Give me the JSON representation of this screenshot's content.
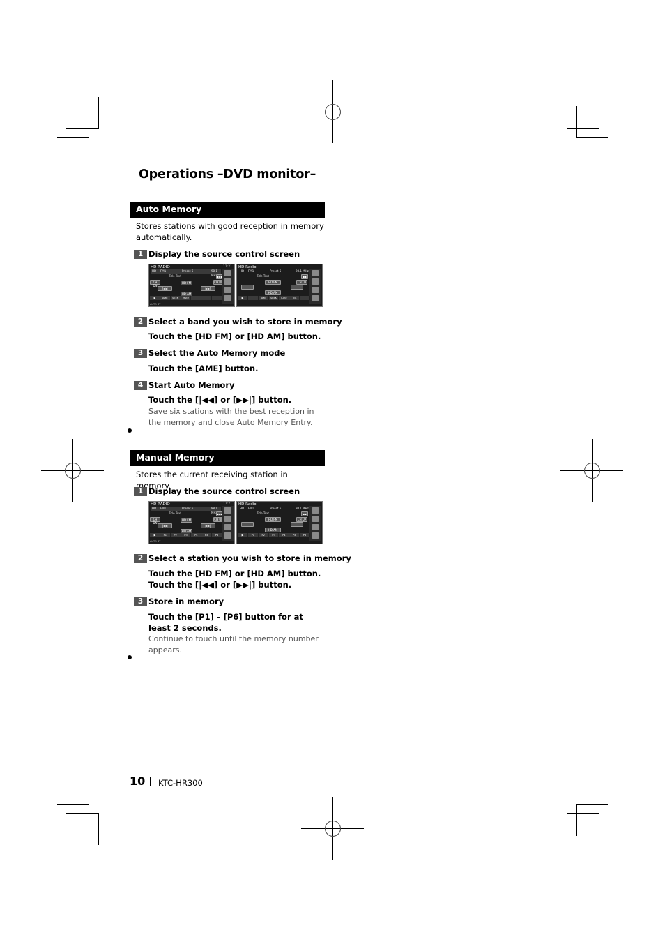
{
  "page_title": "Operations –DVD monitor–",
  "sections": [
    {
      "heading": "Auto Memory",
      "intro": "Stores stations with good reception in memory automatically.",
      "steps": [
        {
          "num": "1",
          "title": "Display the source control screen"
        },
        {
          "num": "2",
          "title": "Select a band you wish to store in memory",
          "instructions": [
            "Touch the [HD FM] or [HD AM] button."
          ]
        },
        {
          "num": "3",
          "title": "Select the Auto Memory mode",
          "instructions": [
            "Touch the [AME] button."
          ]
        },
        {
          "num": "4",
          "title": "Start Auto Memory",
          "instructions": [
            "Touch the [|◀◀] or [▶▶|] button."
          ],
          "note": "Save six stations with the best reception in the memory and close Auto Memory Entry."
        }
      ]
    },
    {
      "heading": "Manual Memory",
      "intro": "Stores the current receiving station in memory.",
      "steps": [
        {
          "num": "1",
          "title": "Display the source control screen"
        },
        {
          "num": "2",
          "title": "Select a station you wish to store in memory",
          "instructions": [
            "Touch the [HD FM] or [HD AM] button.",
            "Touch the [|◀◀] or [▶▶|] button."
          ]
        },
        {
          "num": "3",
          "title": "Store in memory",
          "instructions": [
            "Touch the [P1] – [P6] button for at least 2 seconds."
          ],
          "note": "Continue to touch until the memory number appears."
        }
      ]
    }
  ],
  "screens": {
    "left": {
      "title": "HD RADIO",
      "time": "11:21",
      "band": "HD",
      "channel": "FM1",
      "preset": "Preset 6",
      "freq": "98.1 MHz",
      "title_text": "Title Text",
      "seek_down": "CH DN",
      "seek_up": "CH UP",
      "hd_fm": "HD FM",
      "hd_am": "HD AM",
      "prev": "|◀◀",
      "next": "▶▶|",
      "menu": "▪▪▪",
      "auto_row": [
        "▶",
        "AME",
        "SEEK",
        "Mute",
        "",
        "",
        ""
      ],
      "manual_row": [
        "▶",
        "P1",
        "P2",
        "P3",
        "P4",
        "P5",
        "P6"
      ],
      "foot": "AUTO  ST"
    },
    "right": {
      "title": "HD Radio",
      "band": "HD",
      "channel": "FM1",
      "preset": "Preset 6",
      "freq": "98.1 MHz",
      "title_text": "Title Text",
      "seek_up": "CH UP",
      "hd_fm": "HD FM",
      "hd_am": "HD AM",
      "menu": "▪▪",
      "auto_row": [
        "▶",
        "",
        "AME",
        "SEEK",
        "iLine",
        "TEL",
        ""
      ],
      "manual_row": [
        "▶",
        "P1",
        "P2",
        "P3",
        "P4",
        "P5",
        "P6"
      ]
    }
  },
  "footer": {
    "page_number": "10",
    "model": "KTC-HR300"
  }
}
